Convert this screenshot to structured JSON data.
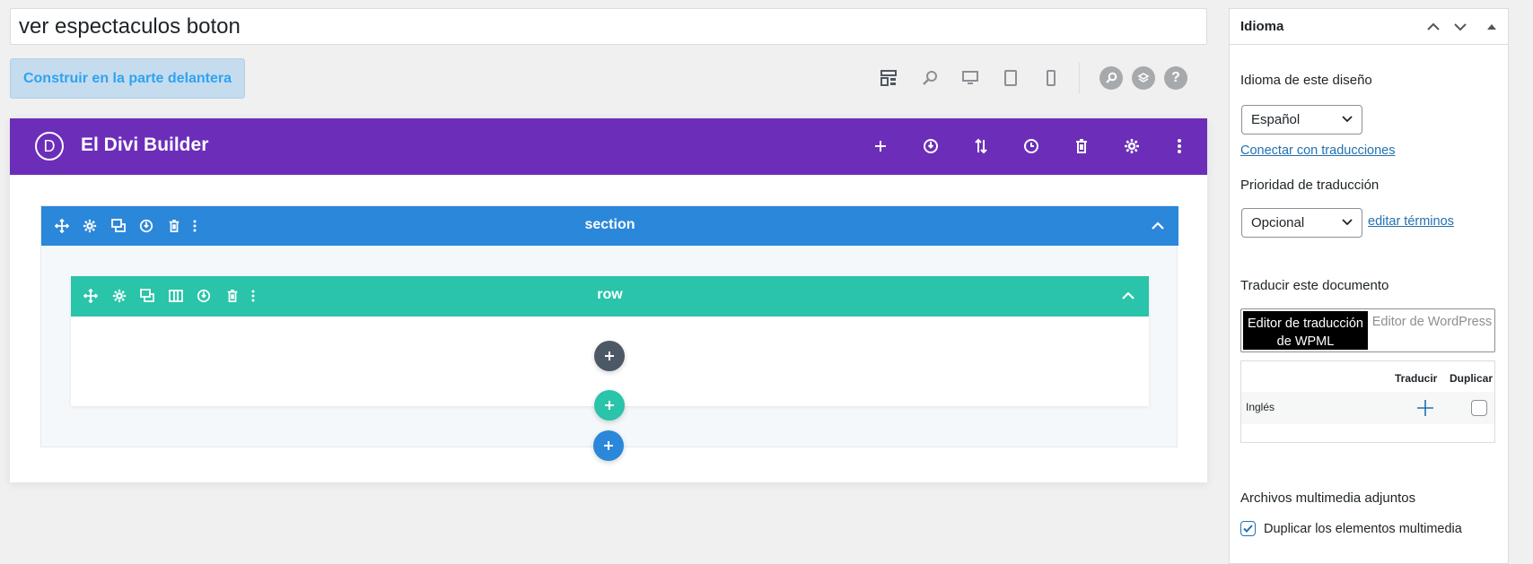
{
  "editor": {
    "post_title": "ver espectaculos boton",
    "build_front_button": "Construir en la parte delantera"
  },
  "toolbar": {
    "icons": [
      "layout-icon",
      "zoom-icon",
      "desktop-icon",
      "tablet-icon",
      "phone-icon",
      "search-icon",
      "layers-icon",
      "help-icon"
    ]
  },
  "divi": {
    "logo_letter": "D",
    "title": "El Divi Builder",
    "header_icons": [
      "plus-icon",
      "power-icon",
      "sort-icon",
      "history-icon",
      "trash-icon",
      "gear-icon",
      "more-icon"
    ],
    "colors": {
      "header": "#6c2eb9",
      "section": "#2b87da",
      "row": "#29c4a9",
      "module_add": "#4c5866"
    },
    "section": {
      "label": "section"
    },
    "row": {
      "label": "row"
    }
  },
  "sidebar": {
    "title": "Idioma",
    "language_label": "Idioma de este diseño",
    "language_value": "Español",
    "connect_link": "Conectar con traducciones",
    "priority_label": "Prioridad de traducción",
    "priority_value": "Opcional",
    "edit_terms_link": "editar términos",
    "translate_label": "Traducir este documento",
    "tab_wpml": "Editor de traducción de WPML",
    "tab_wordpress": "Editor de WordPress",
    "col_translate": "Traducir",
    "col_duplicate": "Duplicar",
    "row_language": "Inglés",
    "media_label": "Archivos multimedia adjuntos",
    "duplicate_media": "Duplicar los elementos multimedia"
  }
}
